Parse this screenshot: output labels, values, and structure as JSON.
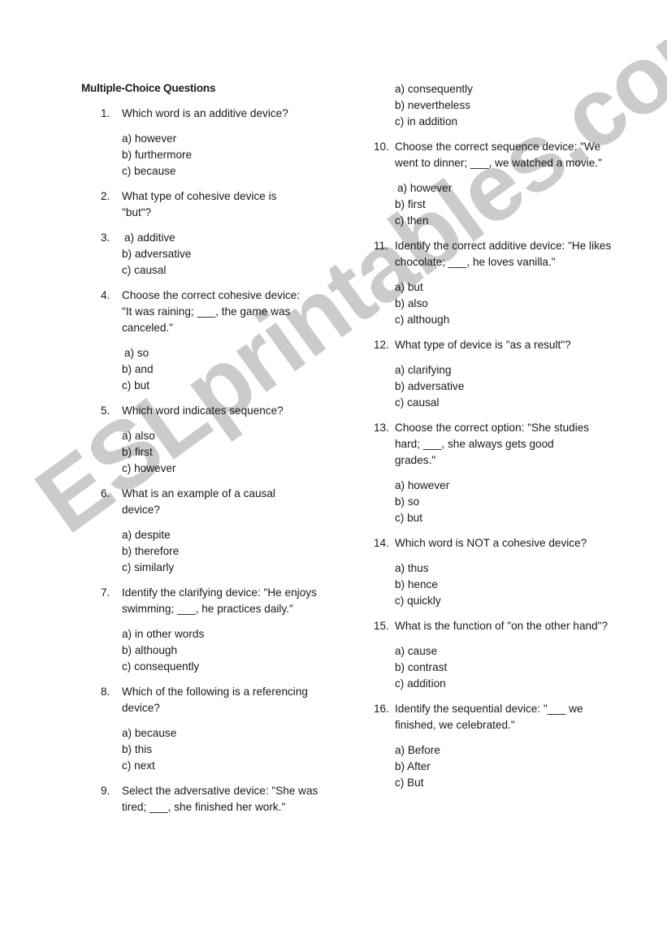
{
  "title": "Multiple-Choice Questions",
  "watermark": "ESLprintables.com",
  "left_column": {
    "q1": {
      "num": "1.",
      "text": "Which word is an additive device?",
      "options": [
        "a) however",
        "b) furthermore",
        "c) because"
      ]
    },
    "q2": {
      "num": "2.",
      "text": "What type of cohesive device is \"but\"?"
    },
    "q3": {
      "num": "3.",
      "options": [
        "a) additive",
        "b) adversative",
        "c) causal"
      ]
    },
    "q4": {
      "num": "4.",
      "text": "Choose the correct cohesive device: \"It was raining; ___, the game was canceled.\"",
      "options": [
        "a) so",
        "b) and",
        "c) but"
      ]
    },
    "q5": {
      "num": "5.",
      "text": "Which word indicates sequence?",
      "options": [
        "a) also",
        "b) first",
        "c) however"
      ]
    },
    "q6": {
      "num": "6.",
      "text": "What is an example of a causal device?",
      "options": [
        "a) despite",
        "b) therefore",
        "c) similarly"
      ]
    },
    "q7": {
      "num": "7.",
      "text": "Identify the clarifying device: \"He enjoys swimming; ___, he practices daily.\"",
      "options": [
        "a) in other words",
        "b) although",
        "c) consequently"
      ]
    },
    "q8": {
      "num": "8.",
      "text": "Which of the following is a referencing device?",
      "options": [
        "a) because",
        "b) this",
        "c) next"
      ]
    },
    "q9": {
      "num": "9.",
      "text": "Select the adversative device: \"She was tired; ___, she finished her work.\""
    }
  },
  "right_column": {
    "q9_options": [
      "a) consequently",
      "b) nevertheless",
      "c) in addition"
    ],
    "q10": {
      "num": "10.",
      "text": "Choose the correct sequence device: \"We went to dinner; ___, we watched a movie.\"",
      "options": [
        "a) however",
        "b) first",
        "c) then"
      ]
    },
    "q11": {
      "num": "11.",
      "text": "Identify the correct additive device: \"He likes chocolate; ___, he loves vanilla.\"",
      "options": [
        "a) but",
        "b) also",
        "c) although"
      ]
    },
    "q12": {
      "num": "12.",
      "text": "What type of device is \"as a result\"?",
      "options": [
        "a) clarifying",
        "b) adversative",
        "c) causal"
      ]
    },
    "q13": {
      "num": "13.",
      "text": "Choose the correct option: \"She studies hard; ___, she always gets good grades.\"",
      "options": [
        "a) however",
        "b) so",
        "c) but"
      ]
    },
    "q14": {
      "num": "14.",
      "text": "Which word is NOT a cohesive device?",
      "options": [
        "a) thus",
        "b) hence",
        "c) quickly"
      ]
    },
    "q15": {
      "num": "15.",
      "text": "What is the function of \"on the other hand\"?",
      "options": [
        "a) cause",
        "b) contrast",
        "c) addition"
      ]
    },
    "q16": {
      "num": "16.",
      "text": "Identify the sequential device: \"___ we finished, we celebrated.\"",
      "options": [
        "a) Before",
        "b) After",
        "c) But"
      ]
    }
  }
}
